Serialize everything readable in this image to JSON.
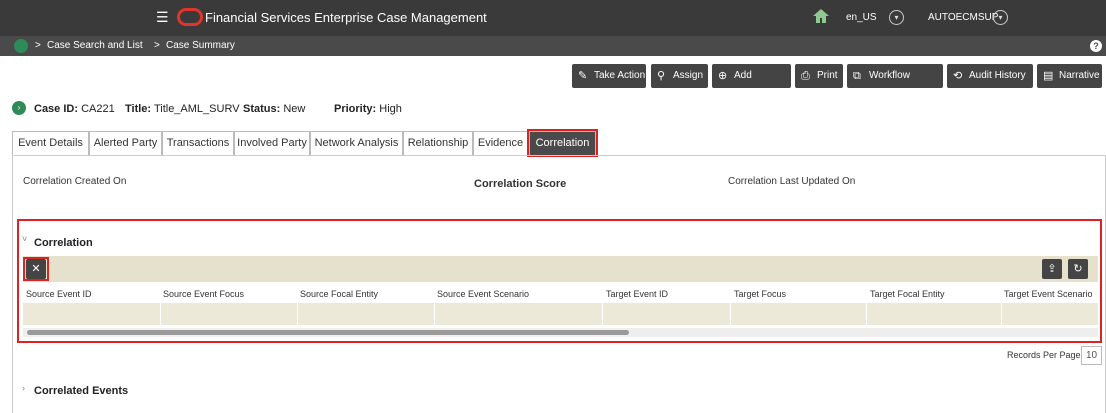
{
  "app": {
    "title": "Financial Services Enterprise Case Management",
    "locale": "en_US",
    "user": "AUTOECMSUP"
  },
  "breadcrumb": {
    "separator": ">",
    "items": [
      "Case Search and List",
      "Case Summary"
    ]
  },
  "toolbar": {
    "take_action": "Take Action",
    "assign": "Assign",
    "add_evidence": "Add Evidence",
    "print": "Print",
    "workflow_monitor": "Workflow Monitor",
    "audit_history": "Audit History",
    "narrative": "Narrative"
  },
  "case": {
    "id_label": "Case ID:",
    "id_value": "CA221",
    "title_label": "Title:",
    "title_value": "Title_AML_SURV",
    "status_label": "Status:",
    "status_value": "New",
    "priority_label": "Priority:",
    "priority_value": "High"
  },
  "tabs": [
    {
      "label": "Event Details"
    },
    {
      "label": "Alerted Party"
    },
    {
      "label": "Transactions"
    },
    {
      "label": "Involved Party"
    },
    {
      "label": "Network Analysis"
    },
    {
      "label": "Relationship"
    },
    {
      "label": "Evidence"
    },
    {
      "label": "Correlation",
      "active": true
    }
  ],
  "correlation_meta": {
    "created_on": "Correlation Created On",
    "score": "Correlation Score",
    "last_updated_on": "Correlation Last Updated On"
  },
  "correlation_section": {
    "title": "Correlation",
    "columns": [
      "Source Event ID",
      "Source Event Focus",
      "Source Focal Entity",
      "Source Event Scenario",
      "Target Event ID",
      "Target Focus",
      "Target Focal Entity",
      "Target Event Scenario"
    ]
  },
  "pagination": {
    "records_per_page_label": "Records Per Page",
    "records_per_page_value": "10"
  },
  "correlated_events": {
    "title": "Correlated Events"
  },
  "colors": {
    "topbar": "#3a3a3a",
    "crumbbar": "#4a4a4a",
    "button": "#444444",
    "grid_toolbar": "#e6e1cc",
    "highlight": "#dd2222",
    "accent_green": "#2e8b57"
  },
  "icons": {
    "menu": "hamburger-icon",
    "home": "home-icon",
    "help": "help-icon",
    "grid_actions": "tools-icon",
    "export": "export-icon",
    "refresh": "refresh-icon"
  }
}
